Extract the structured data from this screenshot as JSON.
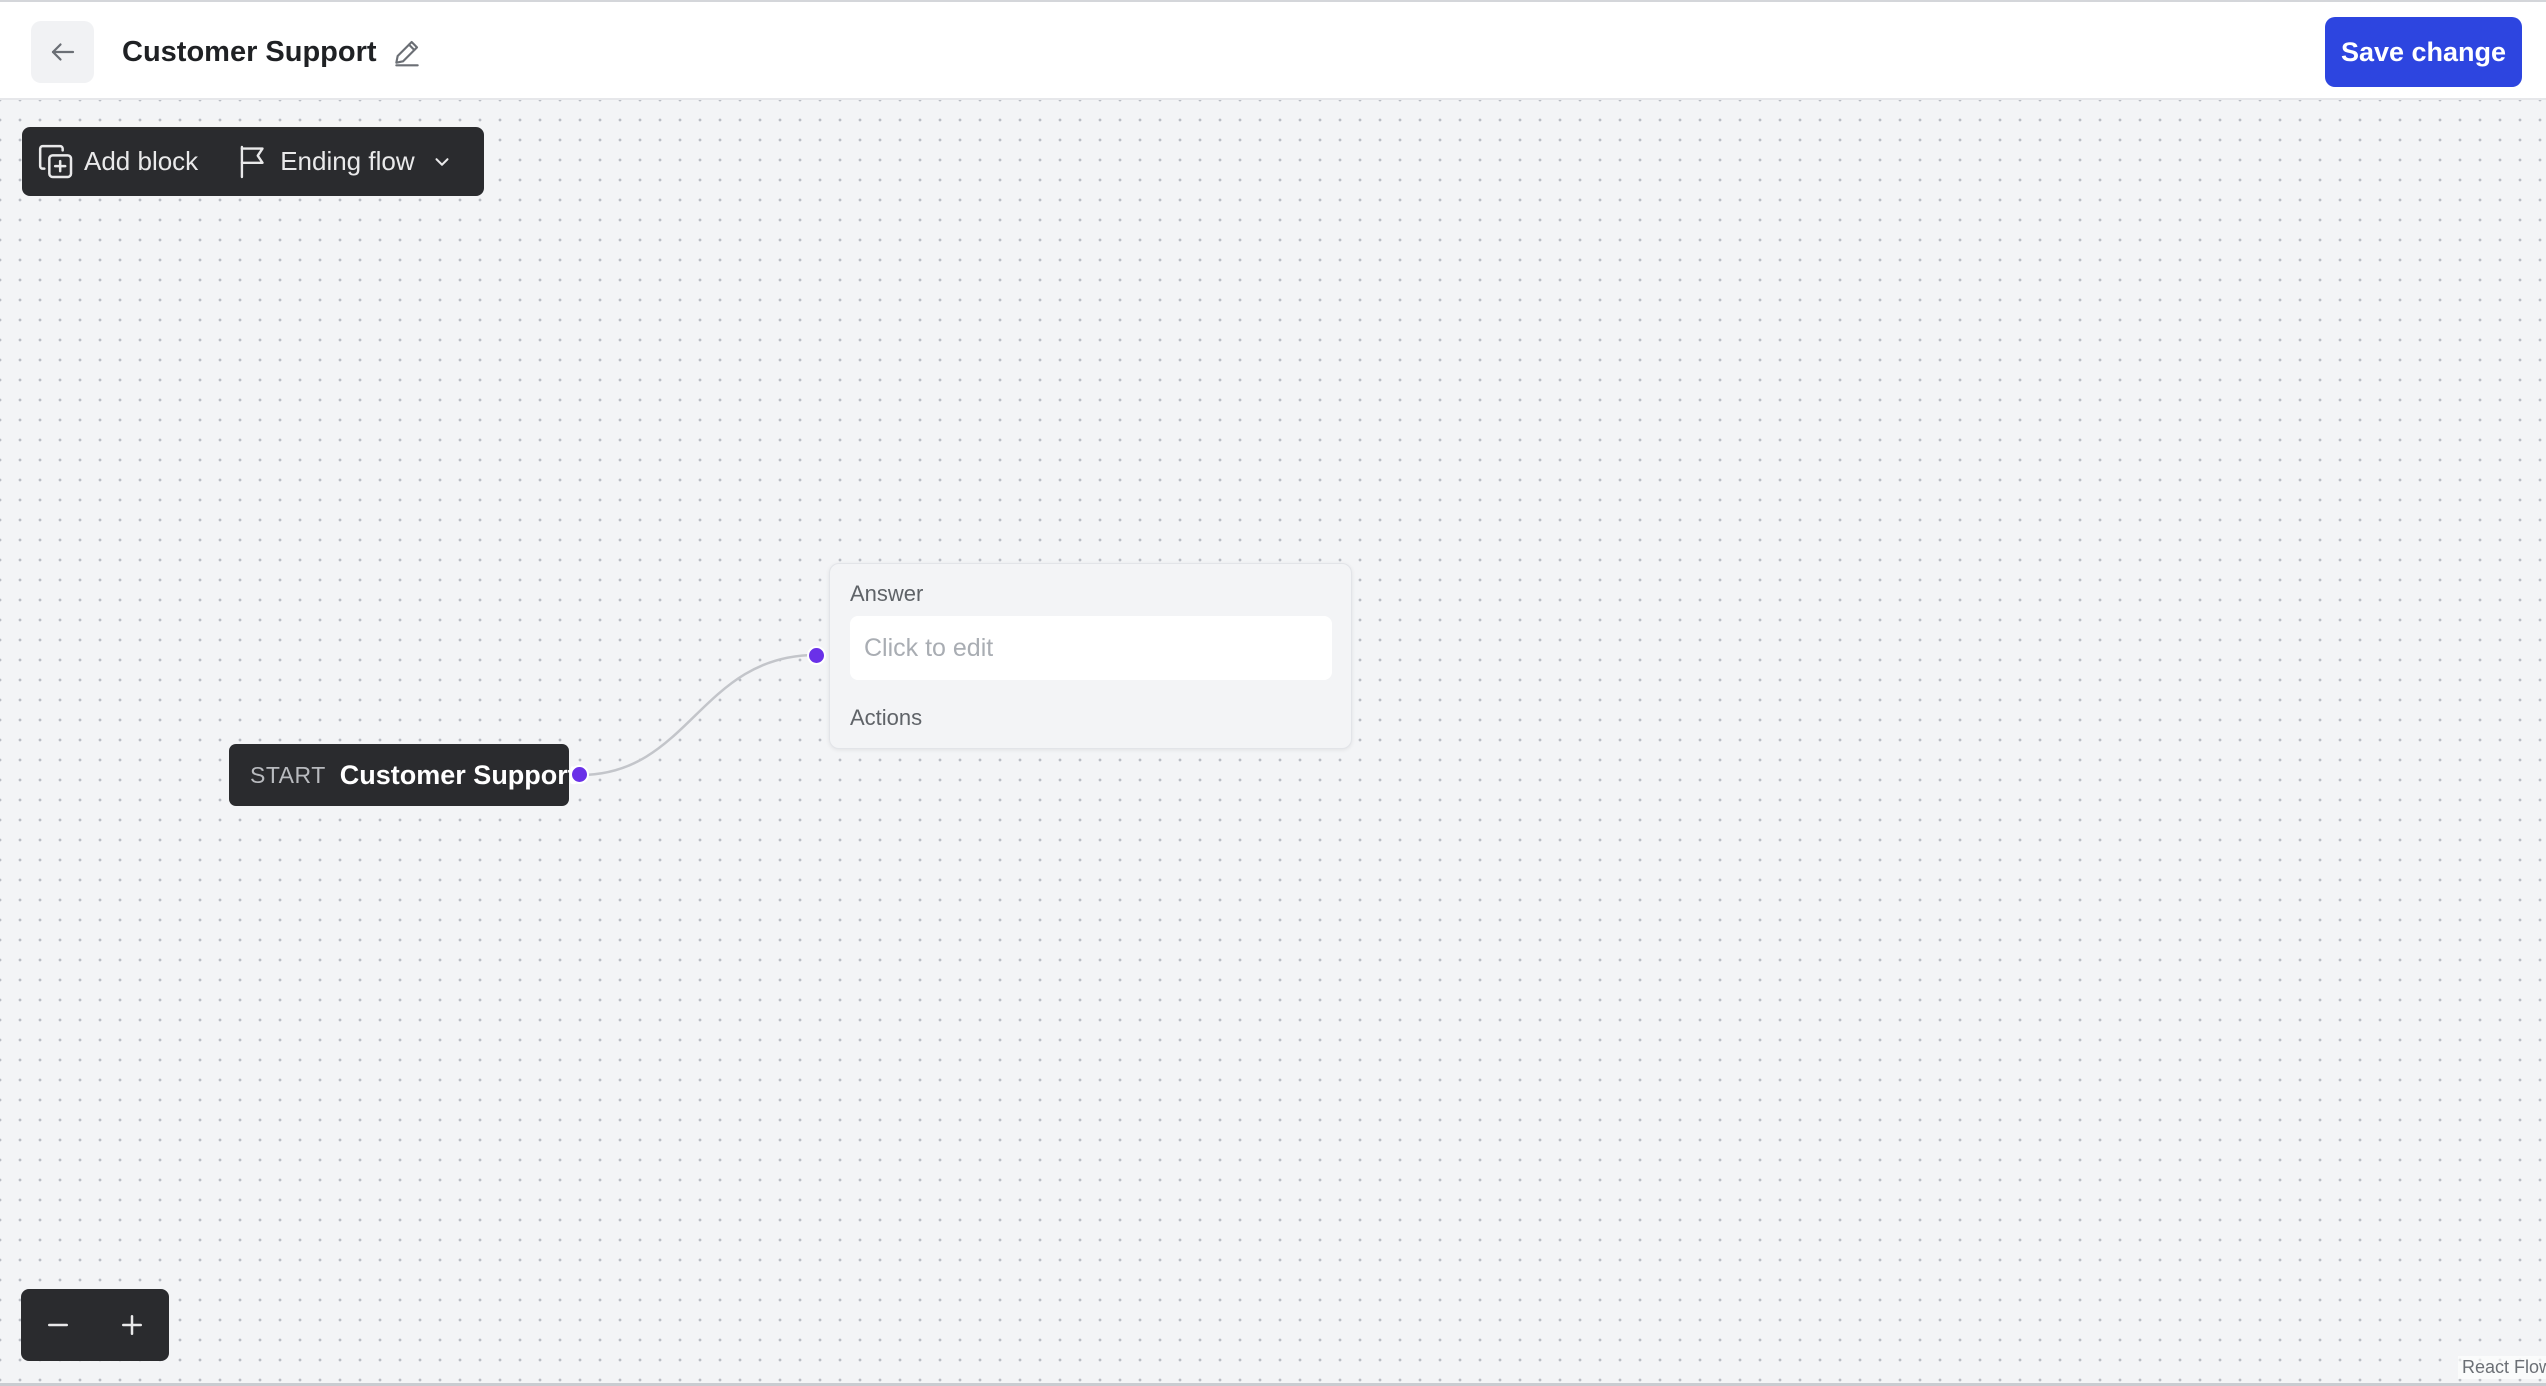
{
  "header": {
    "title": "Customer Support",
    "save_label": "Save change",
    "back_icon": "arrow-left-icon",
    "edit_icon": "pencil-icon"
  },
  "toolbar": {
    "add_block_label": "Add block",
    "add_block_icon": "copy-plus-icon",
    "ending_flow_label": "Ending flow",
    "ending_flow_icon": "flag-icon",
    "dropdown_icon": "chevron-down-icon"
  },
  "nodes": {
    "start": {
      "tag": "START",
      "name": "Customer Support"
    },
    "answer": {
      "label": "Answer",
      "placeholder": "Click to edit",
      "value": "",
      "actions_label": "Actions"
    }
  },
  "zoom": {
    "zoom_out_icon": "minus-icon",
    "zoom_in_icon": "plus-icon"
  },
  "attribution": "React Flow",
  "colors": {
    "accent": "#2d45e0",
    "handle": "#6a31e8",
    "node_dark": "#2a2b2e",
    "canvas": "#f3f4f6"
  }
}
